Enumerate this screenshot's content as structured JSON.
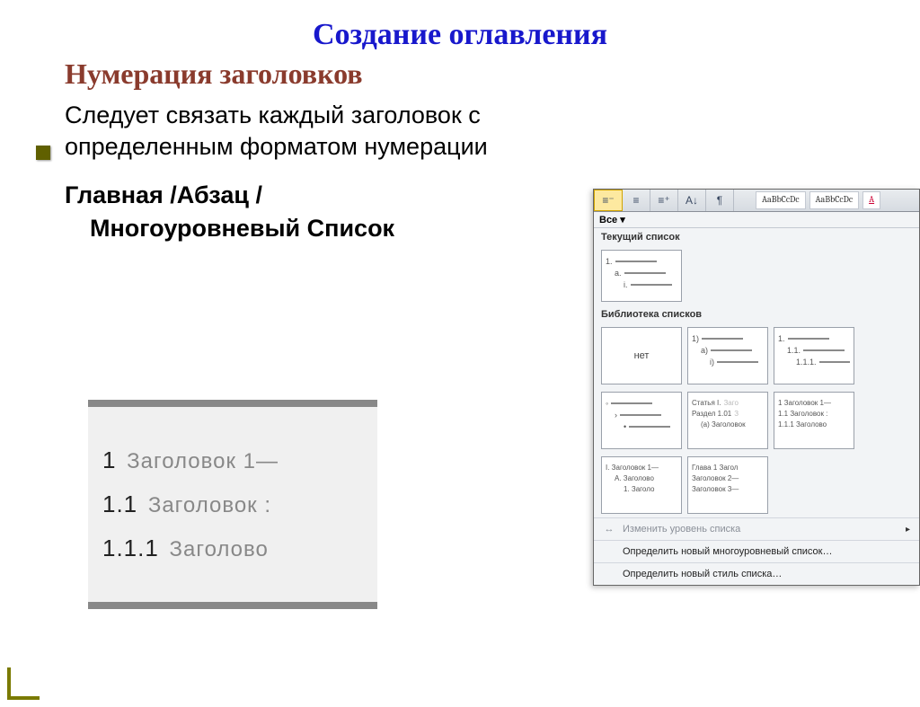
{
  "slide": {
    "title": "Создание оглавления",
    "subtitle": "Нумерация заголовков",
    "body": "Следует связать каждый заголовок с определенным форматом нумерации",
    "path_line1": "Главная /Абзац /",
    "path_line2": "Многоуровневый Список"
  },
  "sample": {
    "r1_num": "1",
    "r1_txt": "Заголовок 1—",
    "r2_num": "1.1",
    "r2_txt": "Заголовок :",
    "r3_num": "1.1.1",
    "r3_txt": "Заголово"
  },
  "panel": {
    "toolbar": {
      "icons": [
        "≡⁻",
        "≡",
        "≡⁺",
        "A↓",
        "¶"
      ],
      "style1": "AaBbCcDc",
      "style2": "AaBbCcDc",
      "style3": "A"
    },
    "all_label": "Все ▾",
    "sec_current": "Текущий список",
    "current": {
      "l1": "1.",
      "l2": "a.",
      "l3": "i."
    },
    "sec_lib": "Библиотека списков",
    "lib": {
      "none": "нет",
      "t12": {
        "a": "1)",
        "b": "a)",
        "c": "i)"
      },
      "t13": {
        "a": "1.",
        "b": "1.1.",
        "c": "1.1.1."
      },
      "t21": {
        "a": "◦",
        "b": "›",
        "c": "•"
      },
      "t22": {
        "a": "Статья I.",
        "a2": "Заго",
        "b": "Раздел 1.01",
        "b2": "З",
        "c": "(a) Заголовок"
      },
      "t23": {
        "a": "1 Заголовок 1—",
        "b": "1.1 Заголовок :",
        "c": "1.1.1 Заголово"
      },
      "t31": {
        "a": "I. Заголовок 1—",
        "b": "A. Заголово",
        "c": "1. Заголо"
      },
      "t32": {
        "a": "Глава 1 Загол",
        "b": "Заголовок 2—",
        "c": "Заголовок 3—"
      }
    },
    "menu": {
      "m1": "Изменить уровень списка",
      "m2": "Определить новый многоуровневый список…",
      "m3": "Определить новый стиль списка…"
    }
  }
}
